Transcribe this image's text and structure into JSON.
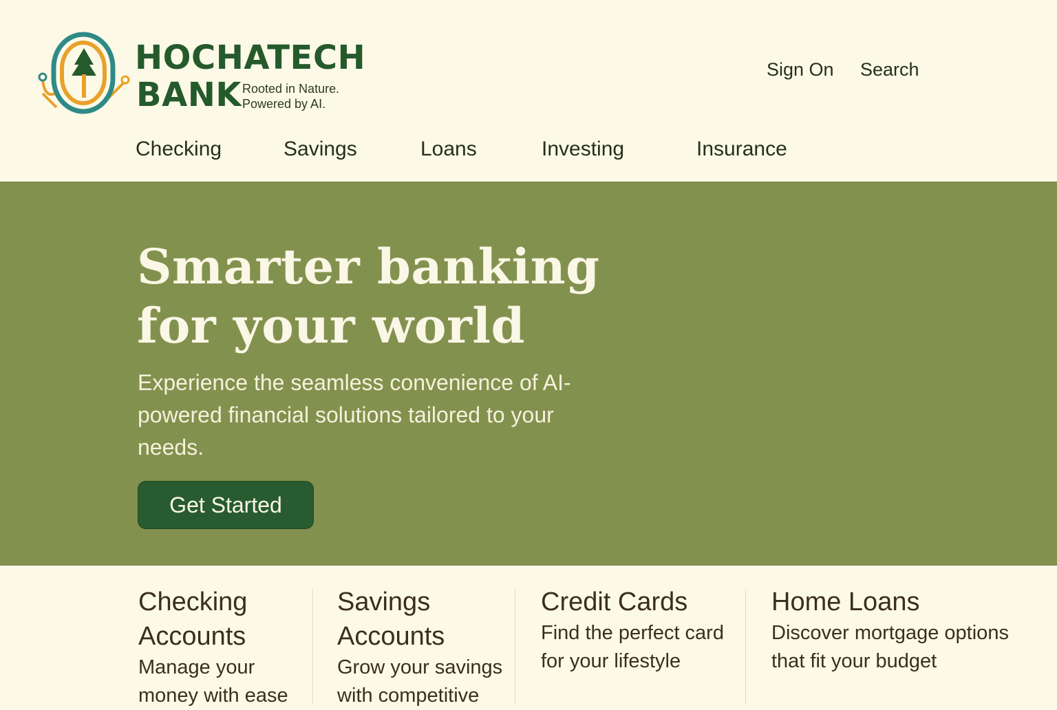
{
  "brand": {
    "name_line1": "HOCHATECH",
    "name_line2": "BANK",
    "tagline_line1": "Rooted in Nature.",
    "tagline_line2": "Powered by AI.",
    "logo_icon": "tree-circuit-icon",
    "colors": {
      "primary_green": "#255a2c",
      "accent_orange": "#e8a12a",
      "accent_teal": "#2f8a86"
    }
  },
  "utility_nav": {
    "sign_on": "Sign On",
    "search": "Search"
  },
  "main_nav": [
    "Checking",
    "Savings",
    "Loans",
    "Investing",
    "Insurance"
  ],
  "hero": {
    "title_line1": "Smarter banking",
    "title_line2": "for your world",
    "subtitle": "Experience the seamless convenience of AI-powered financial solutions tailored to your needs.",
    "cta_label": "Get Started",
    "background_color": "#83914f",
    "cta_color": "#285b30"
  },
  "products": [
    {
      "title": "Checking Accounts",
      "description": "Manage your money with ease"
    },
    {
      "title": "Savings Accounts",
      "description": "Grow your savings with competitive"
    },
    {
      "title": "Credit Cards",
      "description": "Find the perfect card for your lifestyle"
    },
    {
      "title": "Home Loans",
      "description": "Discover mortgage options that fit your budget"
    }
  ]
}
